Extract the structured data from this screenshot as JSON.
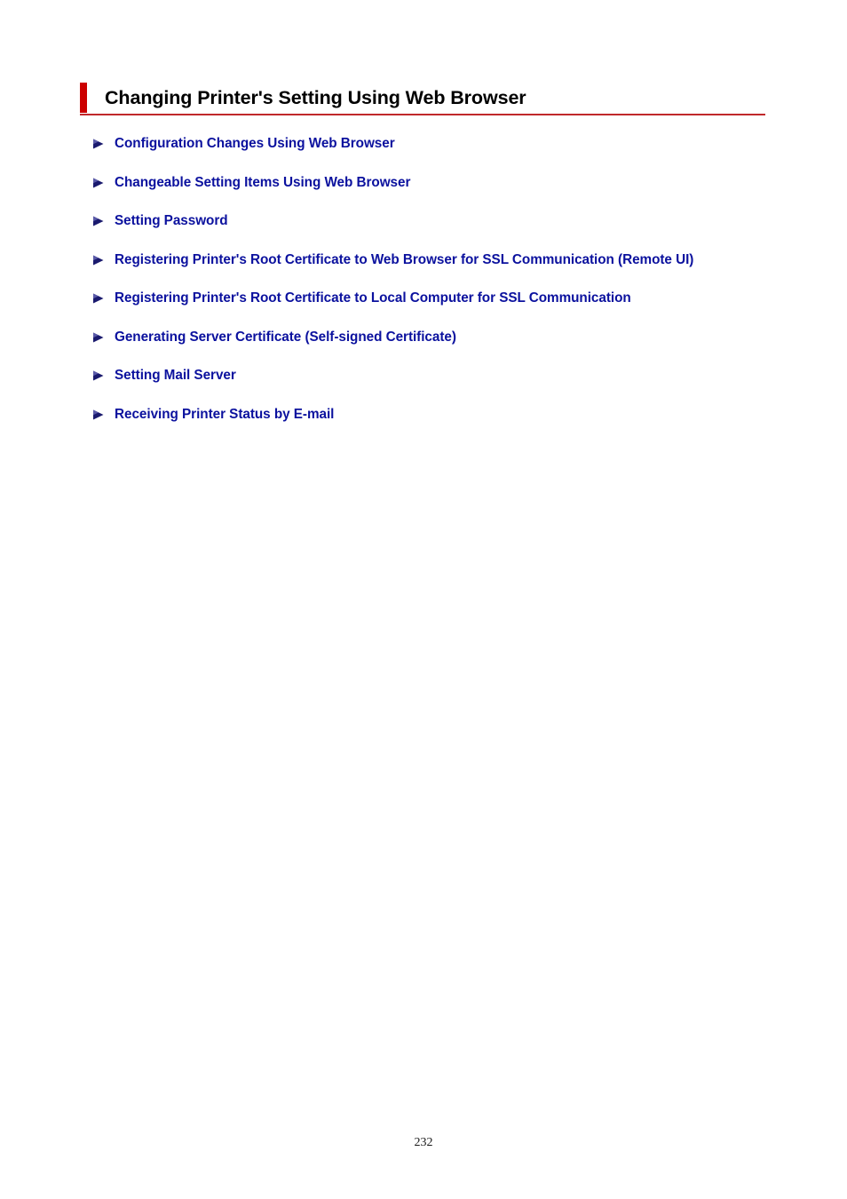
{
  "document": {
    "background_color": "#ffffff",
    "page_number": "232"
  },
  "heading": {
    "title": "Changing Printer's Setting Using Web Browser",
    "accent_color": "#cc0000",
    "rule_color": "#c0282b",
    "text_color": "#000000"
  },
  "link_list": {
    "link_color": "#0b119e",
    "bullet_icon": "arrow-right-bullet-icon",
    "bullet_color": "#1a1a6e",
    "items": [
      {
        "label": "Configuration Changes Using Web Browser"
      },
      {
        "label": "Changeable Setting Items Using Web Browser"
      },
      {
        "label": "Setting Password"
      },
      {
        "label": "Registering Printer's Root Certificate to Web Browser for SSL Communication (Remote UI)"
      },
      {
        "label": "Registering Printer's Root Certificate to Local Computer for SSL Communication"
      },
      {
        "label": "Generating Server Certificate (Self-signed Certificate)"
      },
      {
        "label": "Setting Mail Server"
      },
      {
        "label": "Receiving Printer Status by E-mail"
      }
    ]
  }
}
